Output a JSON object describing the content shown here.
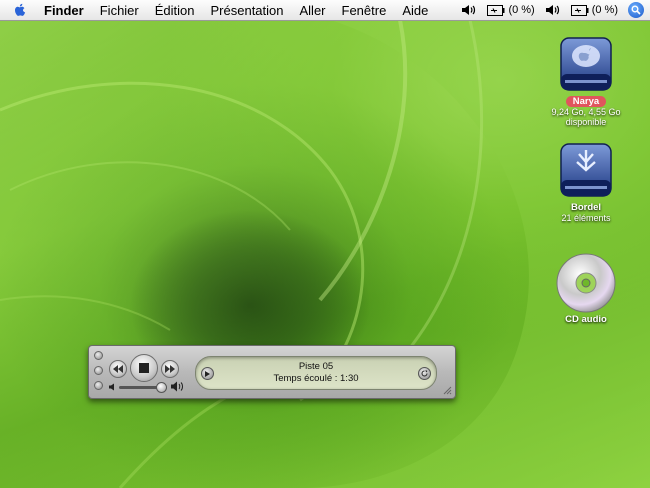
{
  "menubar": {
    "items": [
      "Finder",
      "Fichier",
      "Édition",
      "Présentation",
      "Aller",
      "Fenêtre",
      "Aide"
    ],
    "status": {
      "battery1": "(0 %)",
      "battery2": "(0 %)"
    }
  },
  "desktop_icons": {
    "narya": {
      "name": "Narya",
      "info": "9,24 Go, 4,55 Go disponible"
    },
    "bordel": {
      "name": "Bordel",
      "info": "21 éléments"
    },
    "cd": {
      "name": "CD audio"
    }
  },
  "player": {
    "track": "Piste 05",
    "elapsed": "Temps écoulé : 1:30",
    "volume_level": 0.85
  },
  "colors": {
    "accent": "#1a57c8",
    "selection": "#e0555d"
  }
}
